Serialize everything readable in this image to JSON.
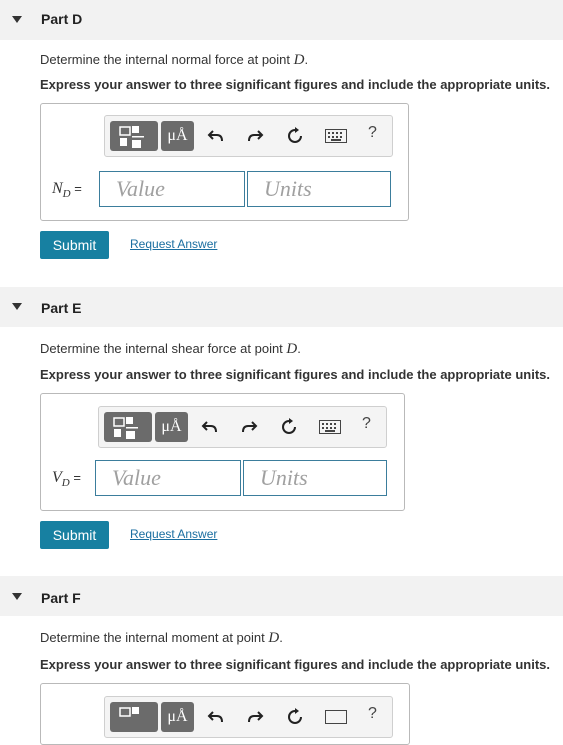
{
  "parts": [
    {
      "title": "Part D",
      "question_text": "Determine the internal normal force at point ",
      "question_var": "D",
      "question_end": ".",
      "instruction": "Express your answer to three significant figures and include the appropriate units.",
      "var_main": "N",
      "var_sub": "D",
      "var_eq": " =",
      "value_placeholder": "Value",
      "units_placeholder": "Units",
      "submit_label": "Submit",
      "request_label": "Request Answer"
    },
    {
      "title": "Part E",
      "question_text": "Determine the internal shear force at point ",
      "question_var": "D",
      "question_end": ".",
      "instruction": "Express your answer to three significant figures and include the appropriate units.",
      "var_main": "V",
      "var_sub": "D",
      "var_eq": " =",
      "value_placeholder": "Value",
      "units_placeholder": "Units",
      "submit_label": "Submit",
      "request_label": "Request Answer"
    },
    {
      "title": "Part F",
      "question_text": "Determine the internal moment at point ",
      "question_var": "D",
      "question_end": ".",
      "instruction": "Express your answer to three significant figures and include the appropriate units."
    }
  ],
  "toolbar": {
    "units_symbol": "μÅ",
    "help_label": "?",
    "icons": [
      "templates-icon",
      "units-icon",
      "undo-icon",
      "redo-icon",
      "reset-icon",
      "keyboard-icon",
      "help-icon"
    ]
  },
  "colors": {
    "header_bg": "#f2f2f2",
    "submit_bg": "#1780a1",
    "link": "#1a6ea0",
    "input_border": "#3b7d9c",
    "toolbar_button": "#6b6b6b"
  }
}
